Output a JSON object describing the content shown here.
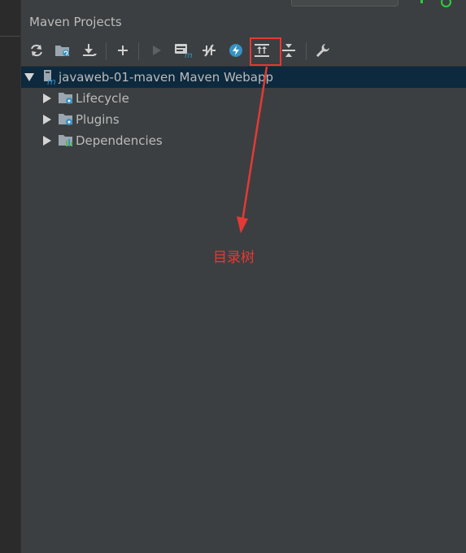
{
  "panel": {
    "title": "Maven Projects"
  },
  "toolbar": {
    "buttons": [
      {
        "name": "reimport-icon"
      },
      {
        "name": "generate-sources-icon"
      },
      {
        "name": "download-icon"
      },
      {
        "name": "add-maven-project-icon"
      },
      {
        "name": "run-maven-build-icon"
      },
      {
        "name": "execute-maven-goal-icon"
      },
      {
        "name": "toggle-offline-mode-icon"
      },
      {
        "name": "skip-tests-icon"
      },
      {
        "name": "show-dependencies-icon"
      },
      {
        "name": "collapse-all-icon"
      },
      {
        "name": "maven-settings-icon"
      }
    ]
  },
  "tree": {
    "root": {
      "label": "javaweb-01-maven Maven Webapp"
    },
    "children": [
      {
        "label": "Lifecycle"
      },
      {
        "label": "Plugins"
      },
      {
        "label": "Dependencies"
      }
    ]
  },
  "annotation": {
    "text": "目录树"
  },
  "colors": {
    "highlight": "#e53935",
    "selected_row": "#0d293e",
    "background": "#3c3f41"
  }
}
